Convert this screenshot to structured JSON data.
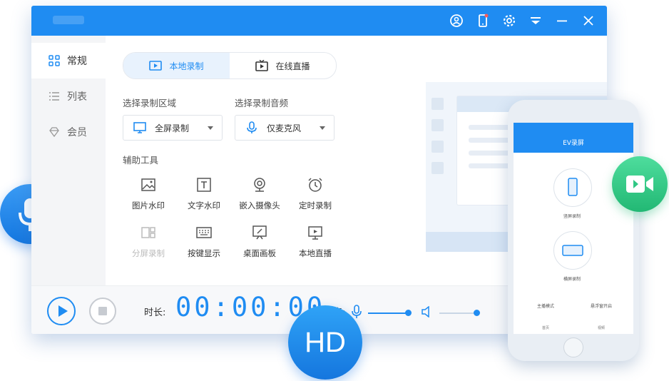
{
  "colors": {
    "accent": "#1f8cf2",
    "sidebar_bg": "#f4f5f7",
    "green": "#2fc784"
  },
  "sidebar": {
    "items": [
      {
        "label": "常规",
        "icon": "grid-icon"
      },
      {
        "label": "列表",
        "icon": "list-icon"
      },
      {
        "label": "会员",
        "icon": "diamond-icon"
      }
    ]
  },
  "tabs": [
    {
      "label": "本地录制",
      "icon": "record-icon"
    },
    {
      "label": "在线直播",
      "icon": "tv-icon"
    }
  ],
  "region": {
    "label": "选择录制区域",
    "value": "全屏录制"
  },
  "audio": {
    "label": "选择录制音频",
    "value": "仅麦克风"
  },
  "tools": {
    "title": "辅助工具",
    "items": [
      {
        "label": "图片水印",
        "icon": "image-icon"
      },
      {
        "label": "文字水印",
        "icon": "text-icon"
      },
      {
        "label": "嵌入摄像头",
        "icon": "webcam-icon"
      },
      {
        "label": "定时录制",
        "icon": "alarm-icon"
      },
      {
        "label": "分屏录制",
        "icon": "split-icon"
      },
      {
        "label": "按键显示",
        "icon": "keyboard-icon"
      },
      {
        "label": "桌面画板",
        "icon": "easel-icon"
      },
      {
        "label": "本地直播",
        "icon": "monitor-icon"
      }
    ]
  },
  "bottom": {
    "duration_label": "时长:",
    "timer": "00:00:00",
    "volume_label": "声音:"
  },
  "badge": {
    "hd": "HD"
  },
  "phone": {
    "app_title": "EV录屏",
    "option1": "竖屏录制",
    "option2": "横屏录制",
    "bottom1": "主播模式",
    "bottom2": "悬浮窗开启",
    "tab1": "首页",
    "tab2": "视频"
  }
}
